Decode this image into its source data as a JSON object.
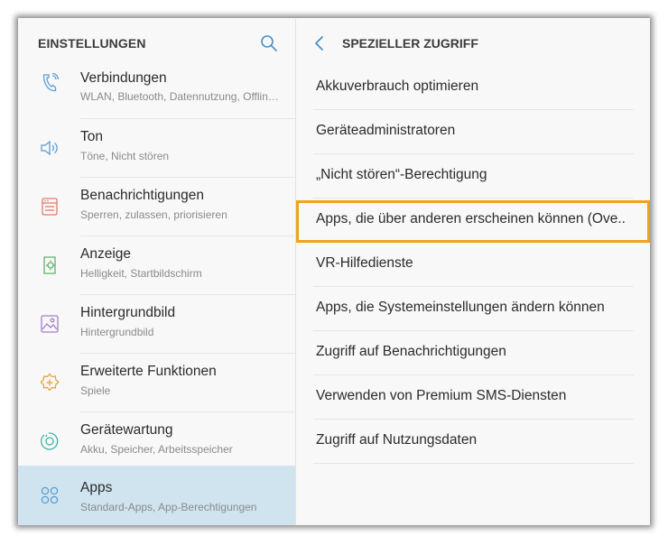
{
  "left_pane": {
    "title": "EINSTELLUNGEN",
    "items": [
      {
        "title": "Verbindungen",
        "subtitle": "WLAN, Bluetooth, Datennutzung, Offline...",
        "icon": "wifi-call-icon"
      },
      {
        "title": "Ton",
        "subtitle": "Töne, Nicht stören",
        "icon": "speaker-icon"
      },
      {
        "title": "Benachrichtigungen",
        "subtitle": "Sperren, zulassen, priorisieren",
        "icon": "notifications-icon"
      },
      {
        "title": "Anzeige",
        "subtitle": "Helligkeit, Startbildschirm",
        "icon": "display-icon"
      },
      {
        "title": "Hintergrundbild",
        "subtitle": "Hintergrundbild",
        "icon": "wallpaper-icon"
      },
      {
        "title": "Erweiterte Funktionen",
        "subtitle": "Spiele",
        "icon": "advanced-features-icon"
      },
      {
        "title": "Gerätewartung",
        "subtitle": "Akku, Speicher, Arbeitsspeicher",
        "icon": "device-maintenance-icon"
      },
      {
        "title": "Apps",
        "subtitle": "Standard-Apps, App-Berechtigungen",
        "icon": "apps-icon",
        "selected": true
      }
    ]
  },
  "right_pane": {
    "title": "SPEZIELLER ZUGRIFF",
    "items": [
      "Akkuverbrauch optimieren",
      "Geräteadministratoren",
      "„Nicht stören“-Berechtigung",
      "Apps, die über anderen erscheinen können (Ove..",
      "VR-Hilfedienste",
      "Apps, die Systemeinstellungen ändern können",
      "Zugriff auf Benachrichtigungen",
      "Verwenden von Premium SMS-Diensten",
      "Zugriff auf Nutzungsdaten"
    ],
    "highlighted_index": 3
  },
  "colors": {
    "accent": "#4a8fc2",
    "highlight": "#f0a21d",
    "selected_bg": "#cfe4ef",
    "icon_blue": "#5a9fd4",
    "icon_red": "#e07b6a",
    "icon_green": "#5fb36b",
    "icon_purple": "#a57fc9",
    "icon_orange": "#e9a23b",
    "icon_teal": "#3eb3a6"
  }
}
